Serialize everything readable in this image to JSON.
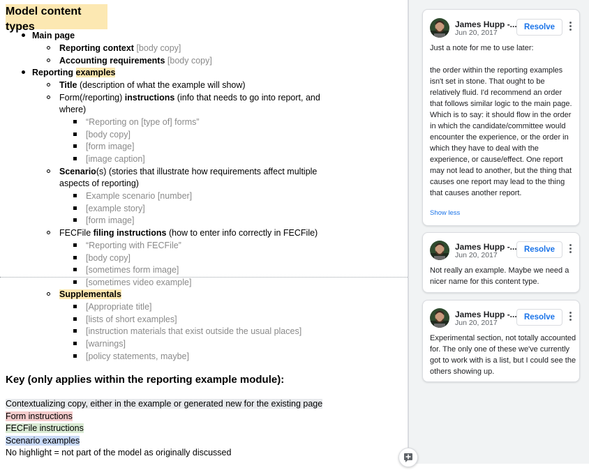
{
  "doc": {
    "title": "Model content types",
    "main_page": "Main page",
    "reporting_context": "Reporting context",
    "body_copy_1": "[body copy]",
    "accounting_requirements": "Accounting requirements",
    "body_copy_2": "[body copy]",
    "reporting_label": "Reporting ",
    "examples_label": "examples",
    "title_label": "Title",
    "title_desc": " (description of what the example will show)",
    "form_prefix": "Form(/reporting) ",
    "instructions_label": "instructions",
    "form_desc": " (info that needs to go into report, and",
    "form_desc2": "where)",
    "form_items": [
      "“Reporting on [type of] forms”",
      "[body copy]",
      "[form image]",
      "[image caption]"
    ],
    "scenario_label": "Scenario",
    "scenario_desc": "(s) (stories that illustrate how requirements affect multiple",
    "scenario_desc2": "aspects of reporting)",
    "scenario_items": [
      "Example scenario [number]",
      "[example story]",
      "[form image]"
    ],
    "fecfile_prefix": "FECFile ",
    "filing_instructions": "filing instructions",
    "fecfile_desc": " (how to enter info correctly in FECFile)",
    "fecfile_items": [
      "“Reporting with FECFile”",
      "[body copy]",
      "[sometimes form image]",
      "[sometimes video example]"
    ],
    "supplementals": "Supplementals",
    "supplemental_items": [
      "[Appropriate title]",
      "[lists of short examples]",
      "[instruction materials that exist outside the usual places]",
      "[warnings]",
      "[policy statements, maybe]"
    ],
    "key_title": "Key (only applies within the reporting example module):",
    "key_items": [
      "Contextualizing copy, either in the example or generated new for the existing page",
      "Form instructions",
      "FECFile instructions",
      "Scenario examples",
      "No highlight = not part of the model as originally discussed"
    ]
  },
  "comments": [
    {
      "author": "James Hupp -...",
      "date": "Jun 20, 2017",
      "resolve": "Resolve",
      "paragraphs": [
        "Just a note for me to use later:",
        "the order within the reporting examples isn't set in stone. That ought to be relatively fluid. I'd recommend an order that follows similar logic to the main page. Which is to say: it should flow in the order in which the candidate/committee would encounter the experience, or the order in which they have to deal with the experience, or cause/effect. One report may not lead to another, but the thing that causes one report may lead to the thing that causes another report."
      ],
      "show_less": "Show less"
    },
    {
      "author": "James Hupp -...",
      "date": "Jun 20, 2017",
      "resolve": "Resolve",
      "paragraphs": [
        "Not really an example. Maybe we need a nicer name for this content type."
      ]
    },
    {
      "author": "James Hupp -...",
      "date": "Jun 20, 2017",
      "resolve": "Resolve",
      "paragraphs": [
        "Experimental section, not totally accounted for. The only one of these we've currently got to work with is a list, but I could see the others showing up."
      ]
    }
  ],
  "icons": {
    "add_comment": "add-comment-icon",
    "more": "more-vert-icon",
    "avatar": "user-avatar"
  },
  "colors": {
    "yellow": "#fce8b2",
    "gray": "#e8eaed",
    "pink": "#f4cccc",
    "green": "#d9ead3",
    "blue": "#c9daf8",
    "link": "#1a73e8"
  }
}
